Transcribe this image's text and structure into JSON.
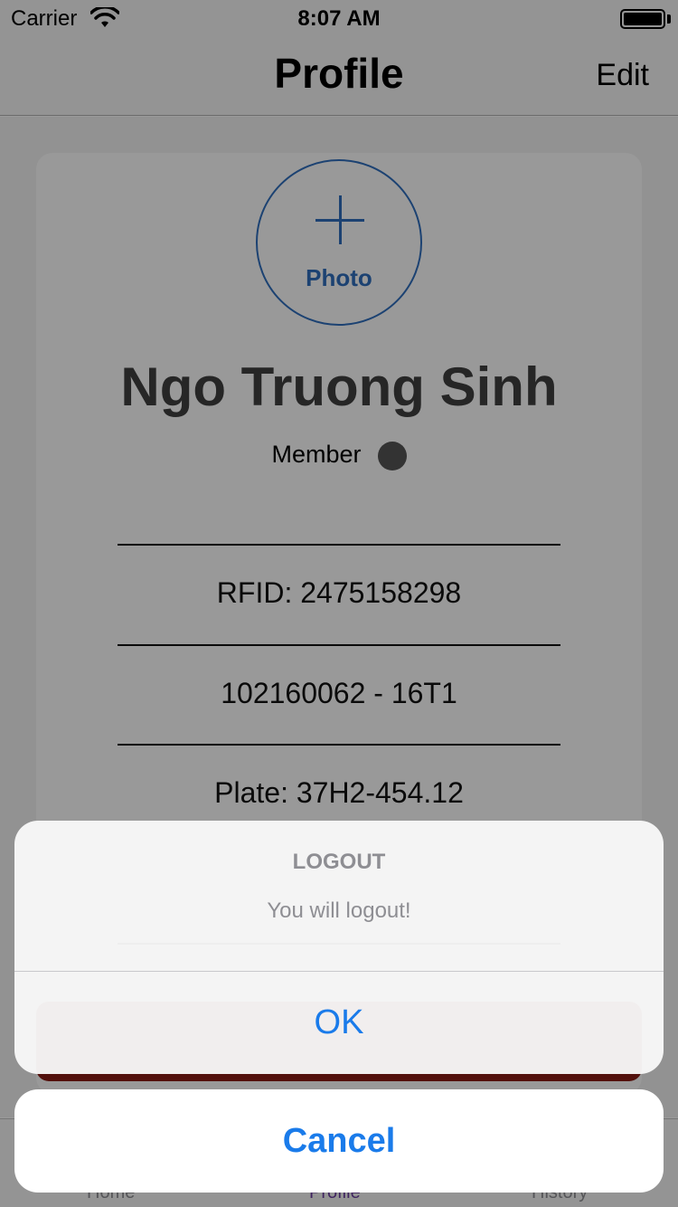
{
  "status_bar": {
    "carrier": "Carrier",
    "time": "8:07 AM"
  },
  "nav": {
    "title": "Profile",
    "edit_label": "Edit"
  },
  "profile": {
    "photo_label": "Photo",
    "name": "Ngo Truong Sinh",
    "role": "Member",
    "rfid": "RFID: 2475158298",
    "student_id": "102160062 - 16T1",
    "plate": "Plate: 37H2-454.12"
  },
  "tabs": [
    {
      "label": "Home"
    },
    {
      "label": "Profile"
    },
    {
      "label": "History"
    }
  ],
  "action_sheet": {
    "title": "LOGOUT",
    "message": "You will logout!",
    "ok_label": "OK",
    "cancel_label": "Cancel"
  },
  "colors": {
    "accent_blue": "#1a7bea",
    "photo_blue": "#2f6fbf",
    "logout_red": "#8a1c14",
    "tab_active": "#6b3fa0"
  }
}
